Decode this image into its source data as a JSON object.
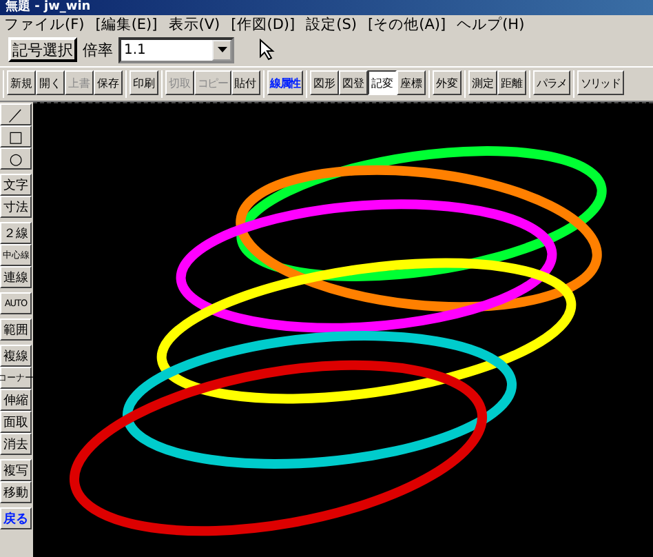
{
  "window": {
    "title": "無題 - jw_win"
  },
  "menu": [
    "ファイル(F)",
    "[編集(E)]",
    "表示(V)",
    "[作図(D)]",
    "設定(S)",
    "[その他(A)]",
    "ヘルプ(H)"
  ],
  "toolbar1": {
    "button": "記号選択",
    "scale_label": "倍率",
    "scale_value": "1.1"
  },
  "toolbar2": [
    [
      {
        "label": "新規",
        "disabled": false
      },
      {
        "label": "開く",
        "disabled": false
      },
      {
        "label": "上書",
        "disabled": true
      },
      {
        "label": "保存",
        "disabled": false
      }
    ],
    [
      {
        "label": "印刷",
        "disabled": false
      }
    ],
    [
      {
        "label": "切取",
        "disabled": true
      },
      {
        "label": "コピー",
        "disabled": true
      },
      {
        "label": "貼付",
        "disabled": false
      }
    ],
    [
      {
        "label": "線属性",
        "kind": "attr",
        "disabled": false
      }
    ],
    [
      {
        "label": "図形",
        "disabled": false
      },
      {
        "label": "図登",
        "disabled": false
      },
      {
        "label": "記変",
        "selected": true,
        "disabled": false
      },
      {
        "label": "座標",
        "disabled": false
      }
    ],
    [
      {
        "label": "外変",
        "disabled": false
      }
    ],
    [
      {
        "label": "測定",
        "disabled": false
      },
      {
        "label": "距離",
        "disabled": false
      }
    ],
    [
      {
        "label": "パラメ",
        "disabled": false
      }
    ],
    [
      {
        "label": "ソリッド",
        "disabled": false
      }
    ]
  ],
  "left_toolbar": [
    [
      {
        "label": "／",
        "kind": "icon"
      },
      {
        "label": "□",
        "kind": "icon"
      },
      {
        "label": "○",
        "kind": "icon"
      }
    ],
    [
      {
        "label": "文字"
      },
      {
        "label": "寸法"
      }
    ],
    [
      {
        "label": "２線"
      },
      {
        "label": "中心線"
      },
      {
        "label": "連線"
      }
    ],
    [
      {
        "label": "AUTO"
      }
    ],
    [
      {
        "label": "範囲"
      }
    ],
    [
      {
        "label": "複線"
      },
      {
        "label": "コーナー"
      },
      {
        "label": "伸縮"
      },
      {
        "label": "面取"
      },
      {
        "label": "消去"
      }
    ],
    [
      {
        "label": "複写"
      },
      {
        "label": "移動"
      }
    ],
    [
      {
        "label": "戻る",
        "kind": "undo"
      }
    ]
  ],
  "strokes": [
    {
      "color": "#00ff33"
    },
    {
      "color": "#ff8000"
    },
    {
      "color": "#ff00ff"
    },
    {
      "color": "#ffff00"
    },
    {
      "color": "#00cccc"
    },
    {
      "color": "#dd0000"
    }
  ]
}
